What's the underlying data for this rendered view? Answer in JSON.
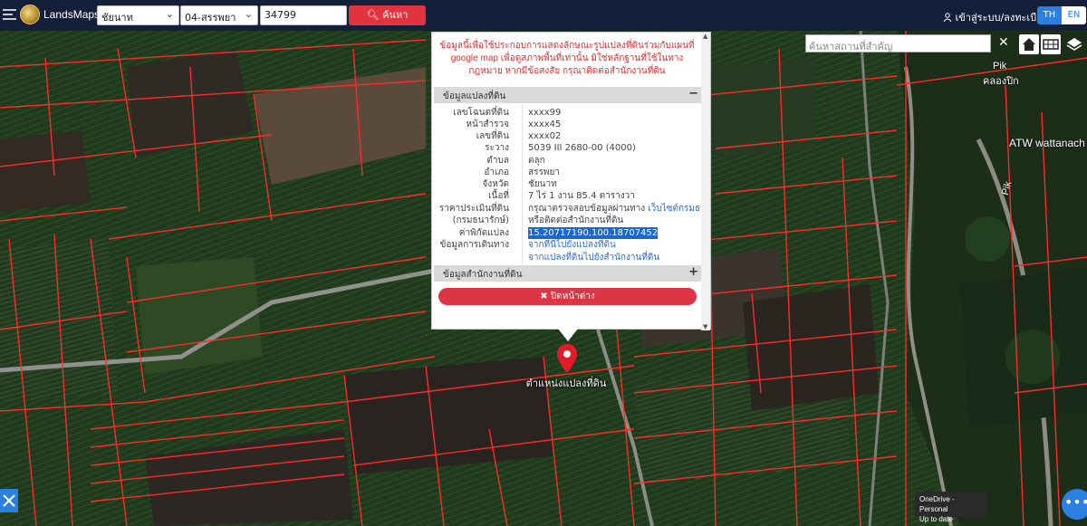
{
  "navbar": {
    "brand": "LandsMaps",
    "province": "ชัยนาท",
    "amphoe": "04-สรรพยา",
    "parcel_number": "34799",
    "search_label": "ค้นหา",
    "login_label": "เข้าสู่ระบบ/ลงทะเบียน",
    "lang_th": "TH",
    "lang_en": "EN"
  },
  "map": {
    "place_search_placeholder": "ค้นหาสถานที่สำคัญ",
    "labels": {
      "pik": "Pik",
      "pik_thai": "คลองปิก",
      "atw": "ATW wattanach",
      "pik_road": "Pik"
    },
    "marker_label": "ตำแหน่งแปลงที่ดิน"
  },
  "popup": {
    "disclaimer": "ข้อมูลนี้เพื่อใช้ประกอบการแสดงลักษณะรูปแปลงที่ดินร่วมกับแผนที่ google map เพื่อดูสภาพพื้นที่เท่านั้น มิใช่หลักฐานที่ใช้ในทางกฎหมาย หากมีข้อสงสัย กรุณาติดต่อสำนักงานที่ดิน",
    "section_parcel": "ข้อมูลแปลงที่ดิน",
    "section_office": "ข้อมูลสำนักงานที่ดิน",
    "rows": [
      {
        "label": "เลขโฉนดที่ดิน",
        "value": "xxxx99"
      },
      {
        "label": "หน้าสำรวจ",
        "value": "xxxx45"
      },
      {
        "label": "เลขที่ดิน",
        "value": "xxxx02"
      },
      {
        "label": "ระวาง",
        "value": "5039 III 2680-00 (4000)"
      },
      {
        "label": "ตำบล",
        "value": "ตลุก"
      },
      {
        "label": "อำเภอ",
        "value": "สรรพยา"
      },
      {
        "label": "จังหวัด",
        "value": "ชัยนาท"
      },
      {
        "label": "เนื้อที่",
        "value": "7 ไร่ 1 งาน 85.4 ตารางวา"
      },
      {
        "label": "ราคาประเมินที่ดิน",
        "value": "กรุณาตรวจสอบข้อมูลผ่านทาง",
        "value_link": "เว็บไซต์กรมธนารักษ์"
      },
      {
        "label": "(กรมธนารักษ์)",
        "value": "หรือติดต่อสำนักงานที่ดิน"
      },
      {
        "label": "ค่าพิกัดแปลง",
        "value": "15.20717190,100.18707452"
      },
      {
        "label": "ข้อมูลการเดินทาง",
        "value": "จากที่นี่ไปยังแปลงที่ดิน"
      },
      {
        "label": "",
        "value": "จากแปลงที่ดินไปยังสำนักงานที่ดิน"
      }
    ],
    "close_label": "✖ ปิดหน้าต่าง",
    "collapse_symbol": "−",
    "expand_symbol": "+"
  },
  "onedrive": {
    "line1": "OneDrive - Personal",
    "line2": "Up to date"
  },
  "colors": {
    "navbar": "#14203a",
    "accent_red": "#e2343f",
    "accent_blue": "#2a7fe0",
    "parcel_line": "#ff2a2a"
  }
}
